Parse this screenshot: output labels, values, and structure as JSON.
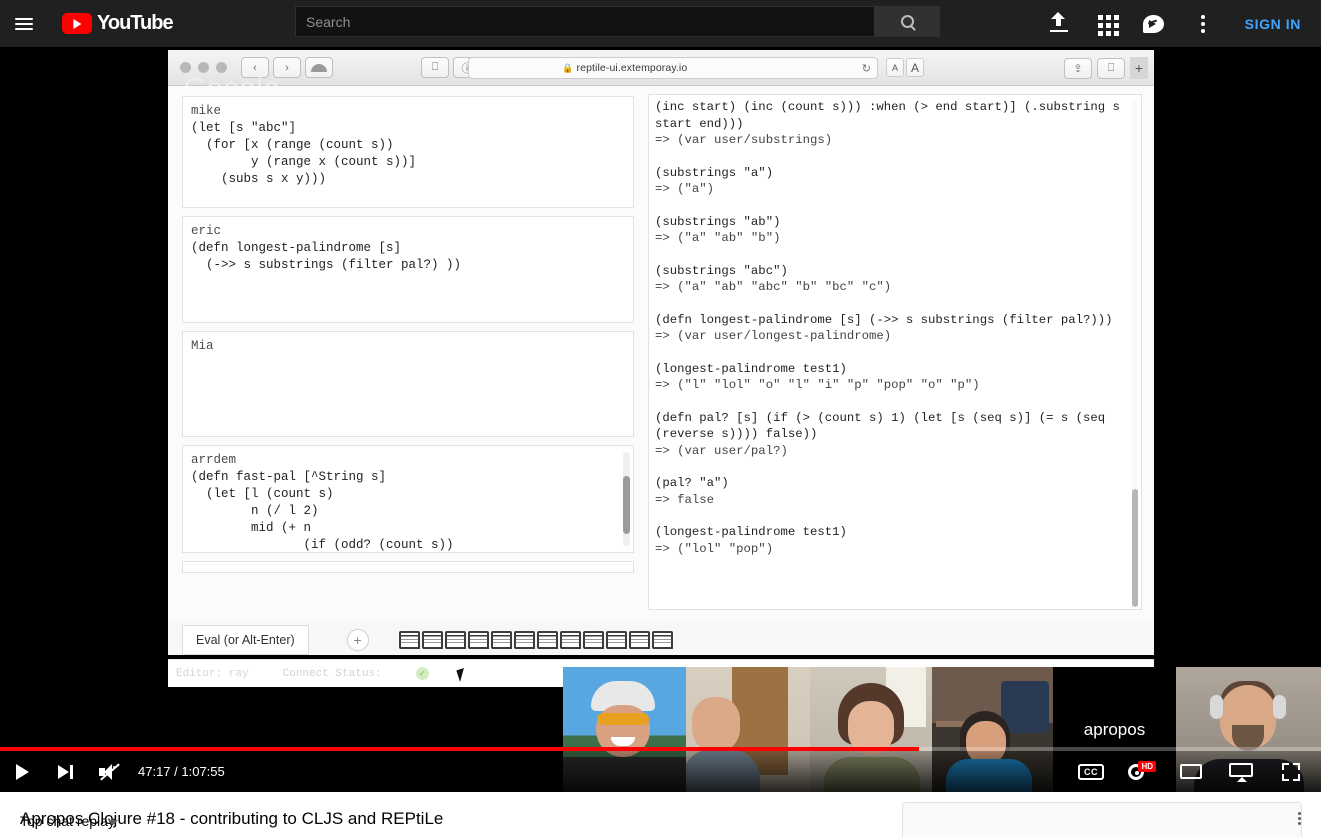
{
  "masthead": {
    "guide_icon": "hamburger-menu-icon",
    "logo_text": "YouTube",
    "search_placeholder": "Search",
    "search_value": "",
    "search_icon": "search-icon",
    "upload_icon": "upload-icon",
    "apps_icon": "apps-grid-icon",
    "messages_icon": "messages-icon",
    "more_icon": "more-vertical-icon",
    "sign_in_label": "SIGN IN",
    "sign_in_color": "#3ea6ff"
  },
  "browser": {
    "url": "reptile-ui.extemporay.io",
    "lock_icon": "lock-icon",
    "reload_icon": "reload-icon",
    "back_icon": "chevron-left-icon",
    "forward_icon": "chevron-right-icon",
    "cloud_icon": "icloud-tabs-icon",
    "sidebar_icon": "sidebar-toggle-icon",
    "reader_icon": "reader-view-icon",
    "shield_icon": "privacy-shield-icon",
    "share_icon": "share-icon",
    "newtab_icon": "new-tab-icon",
    "plus_label": "+",
    "font_small_label": "A",
    "font_large_label": "A",
    "ghost_text": "Google"
  },
  "app": {
    "editors": [
      {
        "user": "mike",
        "code": "(let [s \"abc\"]\n  (for [x (range (count s))\n        y (range x (count s))]\n    (subs s x y)))"
      },
      {
        "user": "eric",
        "code": "(defn longest-palindrome [s]\n  (->> s substrings (filter pal?) ))"
      },
      {
        "user": "Mia",
        "code": ""
      },
      {
        "user": "arrdem",
        "code": "(defn fast-pal [^String s]\n  (let [l (count s)\n        n (/ l 2)\n        mid (+ n\n               (if (odd? (count s))"
      }
    ],
    "repl_entries": [
      {
        "input": "(inc start) (inc (count s))) :when (> end start)] (.substring s\nstart end)))",
        "output": "=> (var user/substrings)"
      },
      {
        "input": "(substrings \"a\")",
        "output": "=> (\"a\")"
      },
      {
        "input": "(substrings \"ab\")",
        "output": "=> (\"a\" \"ab\" \"b\")"
      },
      {
        "input": "(substrings \"abc\")",
        "output": "=> (\"a\" \"ab\" \"abc\" \"b\" \"bc\" \"c\")"
      },
      {
        "input": "(defn longest-palindrome [s] (->> s substrings (filter pal?)))",
        "output": "=> (var user/longest-palindrome)"
      },
      {
        "input": "(longest-palindrome test1)",
        "output": "=> (\"l\" \"lol\" \"o\" \"l\" \"i\" \"p\" \"pop\" \"o\" \"p\")"
      },
      {
        "input": "(defn pal? [s] (if (> (count s) 1) (let [s (seq s)] (= s (seq\n(reverse s)))) false))",
        "output": "=> (var user/pal?)"
      },
      {
        "input": "(pal? \"a\")",
        "output": "=> false"
      },
      {
        "input": "(longest-palindrome test1)",
        "output": "=> (\"lol\" \"pop\")"
      }
    ],
    "toolbar": {
      "eval_label": "Eval (or Alt-Enter)",
      "add_panel_label": "+",
      "add_panel_icon": "plus-circle-icon",
      "panel_icon_name": "panel-window-icon",
      "panel_icon_count": 12
    },
    "status": {
      "editor_label": "Editor: ray",
      "connect_label": "Connect Status:",
      "connect_icon": "connected-check-icon",
      "connect_color": "#7bb45a"
    }
  },
  "webcams": [
    {
      "name": "cyclist-participant"
    },
    {
      "name": "headphones-participant"
    },
    {
      "name": "long-hair-participant"
    },
    {
      "name": "studio-participant"
    },
    {
      "name": "apropos-logo-tile",
      "label": "apropos"
    },
    {
      "name": "headset-participant"
    }
  ],
  "player": {
    "play_icon": "play-icon",
    "next_icon": "next-video-icon",
    "volume_icon": "volume-muted-icon",
    "time_display": "47:17 / 1:07:55",
    "current_time": "47:17",
    "duration": "1:07:55",
    "progress_percent": 69.6,
    "buffered_percent": 56.4,
    "progress_color": "#ff0000",
    "captions_label": "CC",
    "captions_icon": "closed-captions-icon",
    "settings_icon": "settings-gear-icon",
    "quality_badge": "HD",
    "miniplayer_icon": "miniplayer-icon",
    "theater_icon": "theater-mode-icon",
    "fullscreen_icon": "fullscreen-icon"
  },
  "below": {
    "video_title": "Apropos Clojure #18 - contributing to CLJS and REPtiLe",
    "chat_header": "Top chat replay",
    "chat_caret_icon": "chevron-down-icon",
    "chat_menu_icon": "more-vertical-icon"
  }
}
